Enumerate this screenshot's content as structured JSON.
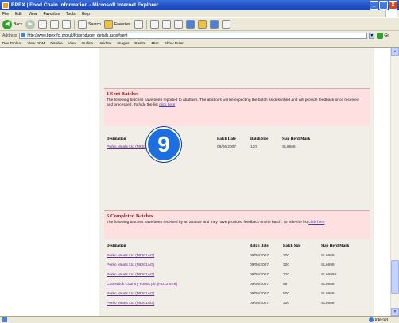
{
  "window": {
    "title": "BPEX | Food Chain Information - Microsoft Internet Explorer",
    "buttons": [
      "_",
      "□",
      "X"
    ]
  },
  "menu": [
    "File",
    "Edit",
    "View",
    "Favorites",
    "Tools",
    "Help"
  ],
  "toolbar": {
    "back": "Back",
    "search": "Search",
    "favorites": "Favorites"
  },
  "address": {
    "label": "Address",
    "url": "http://www.bpex-fci.org.uk/fci/producer_details.aspx#sent",
    "go": "Go"
  },
  "devtoolbar": [
    "Dev Toolbar",
    "View DOM",
    "Disable",
    "View",
    "Outline",
    "Validate",
    "Images",
    "Resize",
    "Misc",
    "Show Ruler"
  ],
  "sent": {
    "title": "1 Sent Batches",
    "desc": "The following batches have been reported to abattoirs. The abattoirs will be expecting the batch as described and will provide feedback once received and processed. To hide the list",
    "hide_link": "click here",
    "columns": [
      "Destination",
      "Batch Date",
      "Batch Size",
      "Slap Herd Mark"
    ],
    "rows": [
      {
        "destination": "Porko Meats Ltd (MK8 1AG)",
        "date": "09/06/2007",
        "size": "120",
        "mark": "SL6666"
      }
    ]
  },
  "completed": {
    "title": "6 Completed Batches",
    "desc": "The following batches have been received by an abattoir and they have provided feedback on the batch. To hide the list",
    "hide_link": "click here",
    "columns": [
      "Destination",
      "Batch Date",
      "Batch Size",
      "Slap Herd Mark"
    ],
    "rows": [
      {
        "destination": "Porko Meats Ltd (MK8 1AG)",
        "date": "09/06/2007",
        "size": "300",
        "mark": "SL6666"
      },
      {
        "destination": "Porko Meats Ltd (MK8 1AG)",
        "date": "09/06/2007",
        "size": "300",
        "mark": "SL6699"
      },
      {
        "destination": "Porko Meats Ltd (MK8 1AG)",
        "date": "09/06/2007",
        "size": "220",
        "mark": "SL6699X"
      },
      {
        "destination": "Cranswick Country Foods plc (HU12 8TB)",
        "date": "09/06/2007",
        "size": "55",
        "mark": "SL6666"
      },
      {
        "destination": "Porko Meats Ltd (MK8 1AG)",
        "date": "09/06/2007",
        "size": "500",
        "mark": "SL6666"
      },
      {
        "destination": "Porko Meats Ltd (MK8 1AG)",
        "date": "09/06/2007",
        "size": "300",
        "mark": "SL6666"
      }
    ]
  },
  "badge": "9",
  "status": {
    "zone": "Internet"
  }
}
